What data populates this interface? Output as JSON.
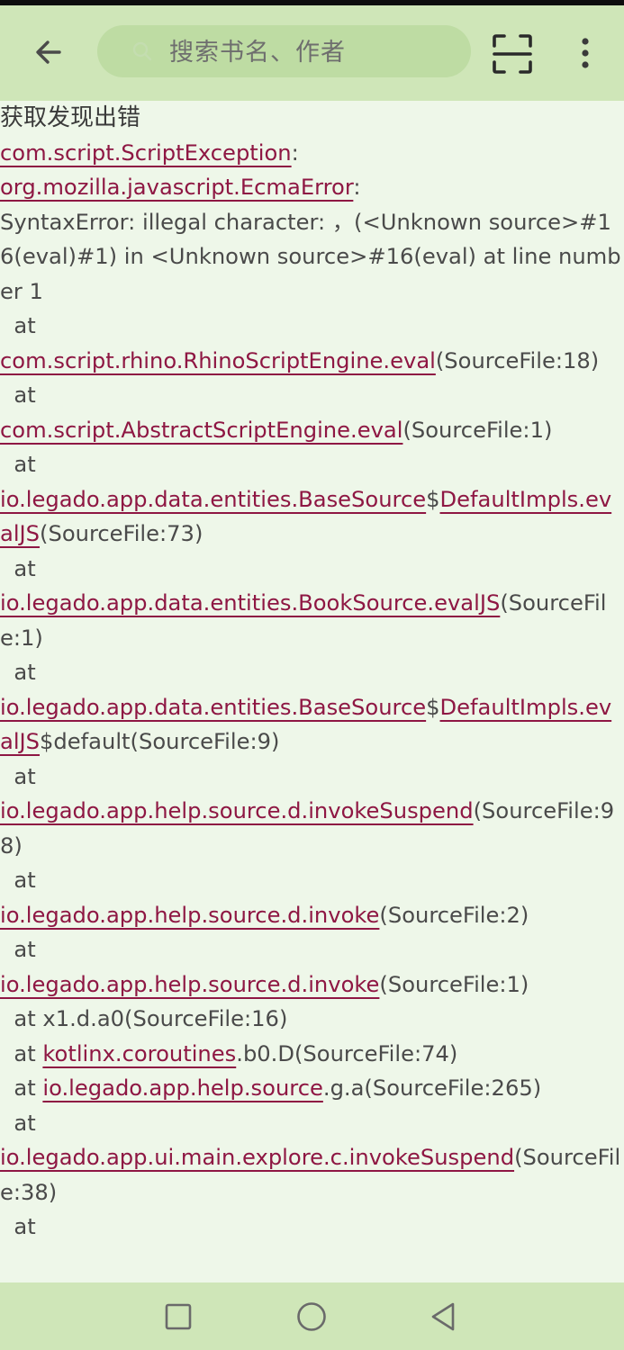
{
  "search": {
    "placeholder": "搜索书名、作者"
  },
  "icons": {
    "back": "arrow-left-icon",
    "search": "search-icon",
    "scan": "scan-icon",
    "more": "more-vert-icon",
    "nav_recent": "square-icon",
    "nav_home": "circle-icon",
    "nav_back": "triangle-back-icon"
  },
  "colors": {
    "topbar": "#cfe6b8",
    "background": "#eef7e9",
    "link": "#8e1743",
    "text": "#4a4a4a"
  },
  "error": {
    "title": "获取发现出错",
    "lines": [
      [
        {
          "t": "com.script.ScriptException",
          "link": true
        },
        {
          "t": ":"
        }
      ],
      [
        {
          "t": "org.mozilla.javascript.EcmaError",
          "link": true
        },
        {
          "t": ":"
        }
      ],
      [
        {
          "t": "SyntaxError: illegal character: ，(<Unknown source>#16(eval)#1) in <Unknown source>#16(eval) at line number 1"
        }
      ],
      [
        {
          "t": "  at "
        }
      ],
      [
        {
          "t": "com.script.rhino.RhinoScriptEngine.eval",
          "link": true
        },
        {
          "t": "(SourceFile:18)"
        }
      ],
      [
        {
          "t": "  at "
        }
      ],
      [
        {
          "t": "com.script.AbstractScriptEngine.eval",
          "link": true
        },
        {
          "t": "(SourceFile:1)"
        }
      ],
      [
        {
          "t": "  at "
        }
      ],
      [
        {
          "t": "io.legado.app.data.entities.BaseSource",
          "link": true
        },
        {
          "t": "$"
        },
        {
          "t": "DefaultImpls.evalJS",
          "link": true
        },
        {
          "t": "(SourceFile:73)"
        }
      ],
      [
        {
          "t": "  at "
        }
      ],
      [
        {
          "t": "io.legado.app.data.entities.BookSource.evalJS",
          "link": true
        },
        {
          "t": "(SourceFile:1)"
        }
      ],
      [
        {
          "t": "  at "
        }
      ],
      [
        {
          "t": "io.legado.app.data.entities.BaseSource",
          "link": true
        },
        {
          "t": "$"
        },
        {
          "t": "DefaultImpls.evalJS",
          "link": true
        },
        {
          "t": "$default(SourceFile:9)"
        }
      ],
      [
        {
          "t": "  at "
        }
      ],
      [
        {
          "t": "io.legado.app.help.source.d.invokeSuspend",
          "link": true
        },
        {
          "t": "(SourceFile:98)"
        }
      ],
      [
        {
          "t": "  at "
        }
      ],
      [
        {
          "t": "io.legado.app.help.source.d.invoke",
          "link": true
        },
        {
          "t": "(SourceFile:2)"
        }
      ],
      [
        {
          "t": "  at "
        }
      ],
      [
        {
          "t": "io.legado.app.help.source.d.invoke",
          "link": true
        },
        {
          "t": "(SourceFile:1)"
        }
      ],
      [
        {
          "t": "  at x1.d.a0(SourceFile:16)"
        }
      ],
      [
        {
          "t": "  at "
        },
        {
          "t": "kotlinx.coroutines",
          "link": true
        },
        {
          "t": ".b0.D(SourceFile:74)"
        }
      ],
      [
        {
          "t": "  at "
        },
        {
          "t": "io.legado.app.help.source",
          "link": true
        },
        {
          "t": ".g.a(SourceFile:265)"
        }
      ],
      [
        {
          "t": "  at "
        }
      ],
      [
        {
          "t": "io.legado.app.ui.main.explore.c.invokeSuspend",
          "link": true
        },
        {
          "t": "(SourceFile:38)"
        }
      ],
      [
        {
          "t": "  at "
        }
      ]
    ]
  }
}
